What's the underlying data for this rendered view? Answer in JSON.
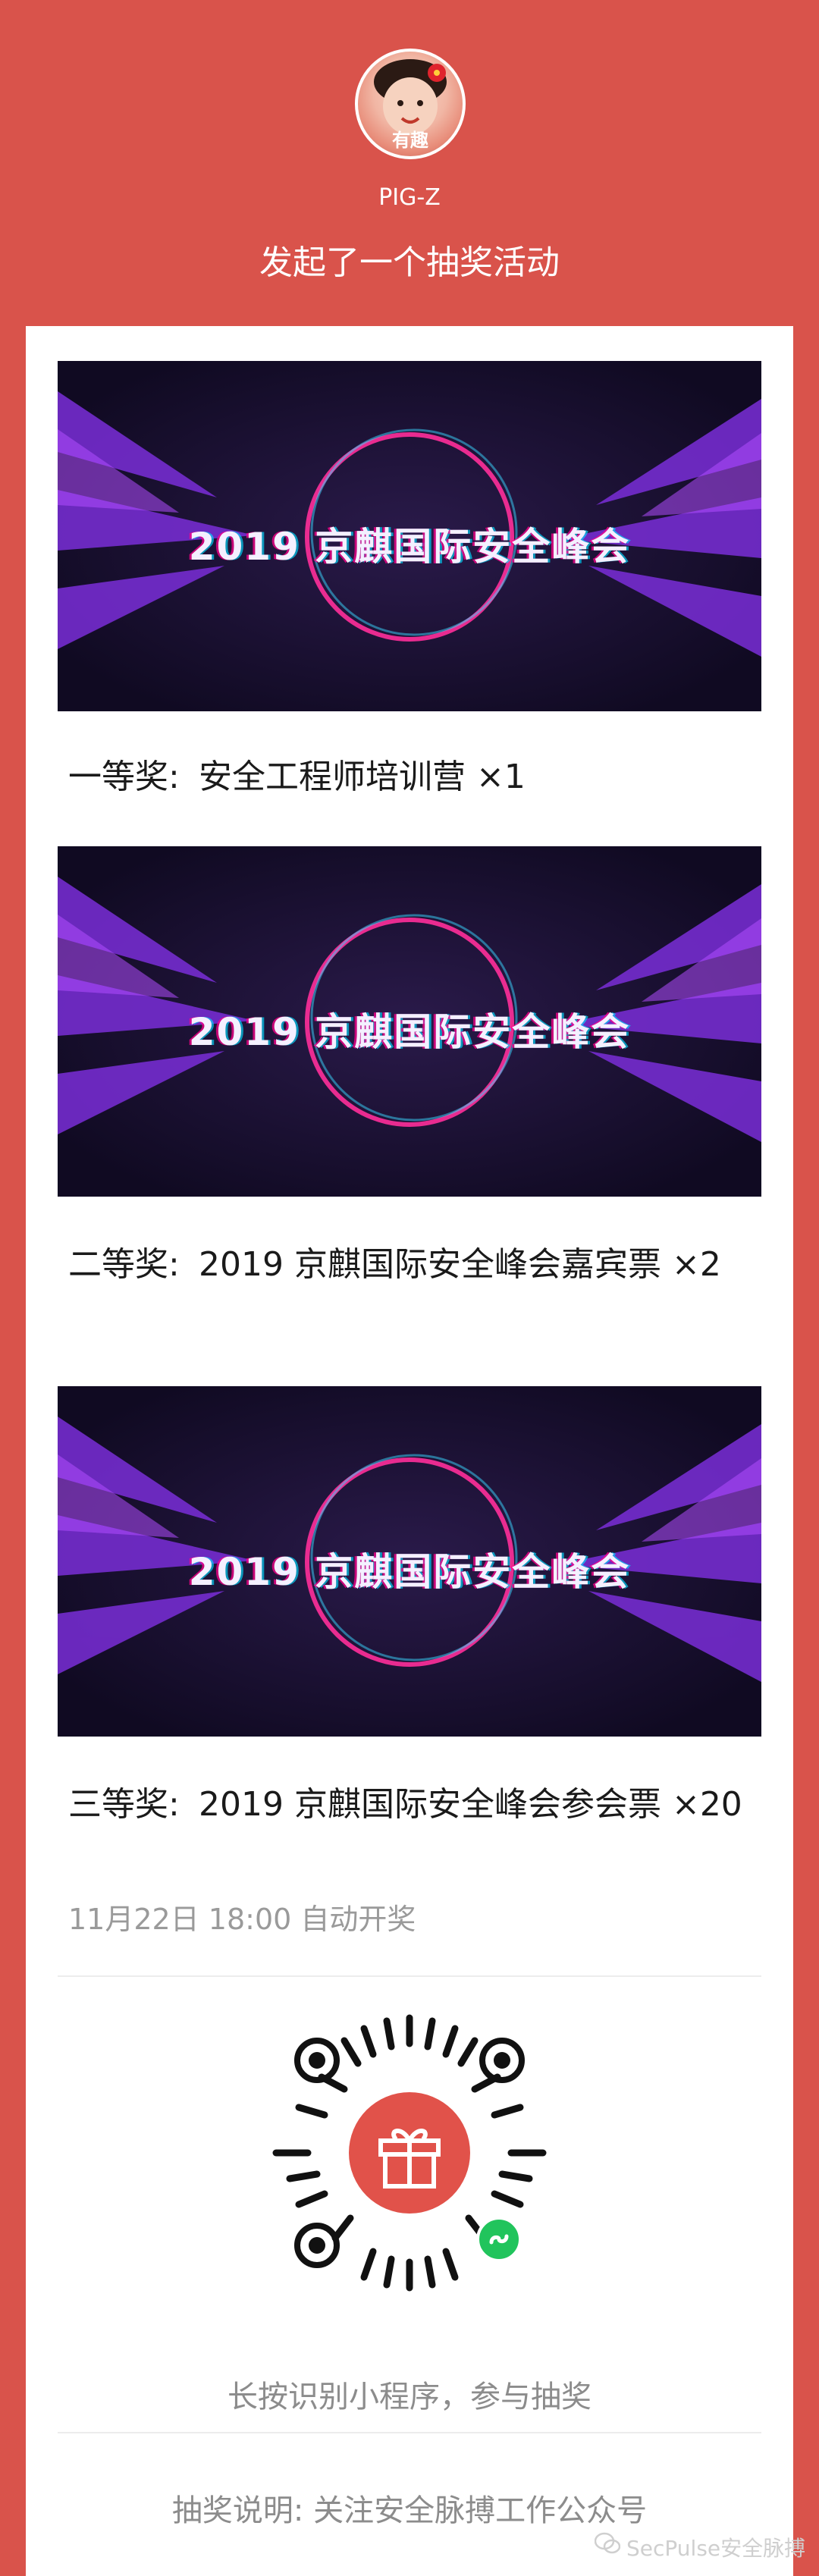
{
  "header": {
    "avatar_tag": "有趣",
    "username": "PIG-Z",
    "subtitle": "发起了一个抽奖活动"
  },
  "banner_text": "2019 京麒国际安全峰会",
  "prizes": [
    {
      "label": "一等奖:",
      "text": "安全工程师培训营 ×1"
    },
    {
      "label": "二等奖:",
      "text": "2019 京麒国际安全峰会嘉宾票 ×2"
    },
    {
      "label": "三等奖:",
      "text": "2019 京麒国际安全峰会参会票 ×20"
    }
  ],
  "deadline": "11月22日 18:00 自动开奖",
  "qr_hint": "长按识别小程序，参与抽奖",
  "note": "抽奖说明: 关注安全脉搏工作公众号",
  "watermark": "SecPulse安全脉搏",
  "icons": {
    "qr": "mini-program-code",
    "center": "gift-icon",
    "badge": "mini-program-icon",
    "watermark": "wechat-icon"
  },
  "colors": {
    "background": "#d9534b",
    "card": "#ffffff",
    "qr_center": "#e1524a",
    "badge": "#21c45c",
    "muted_text": "#9a9a9a"
  }
}
